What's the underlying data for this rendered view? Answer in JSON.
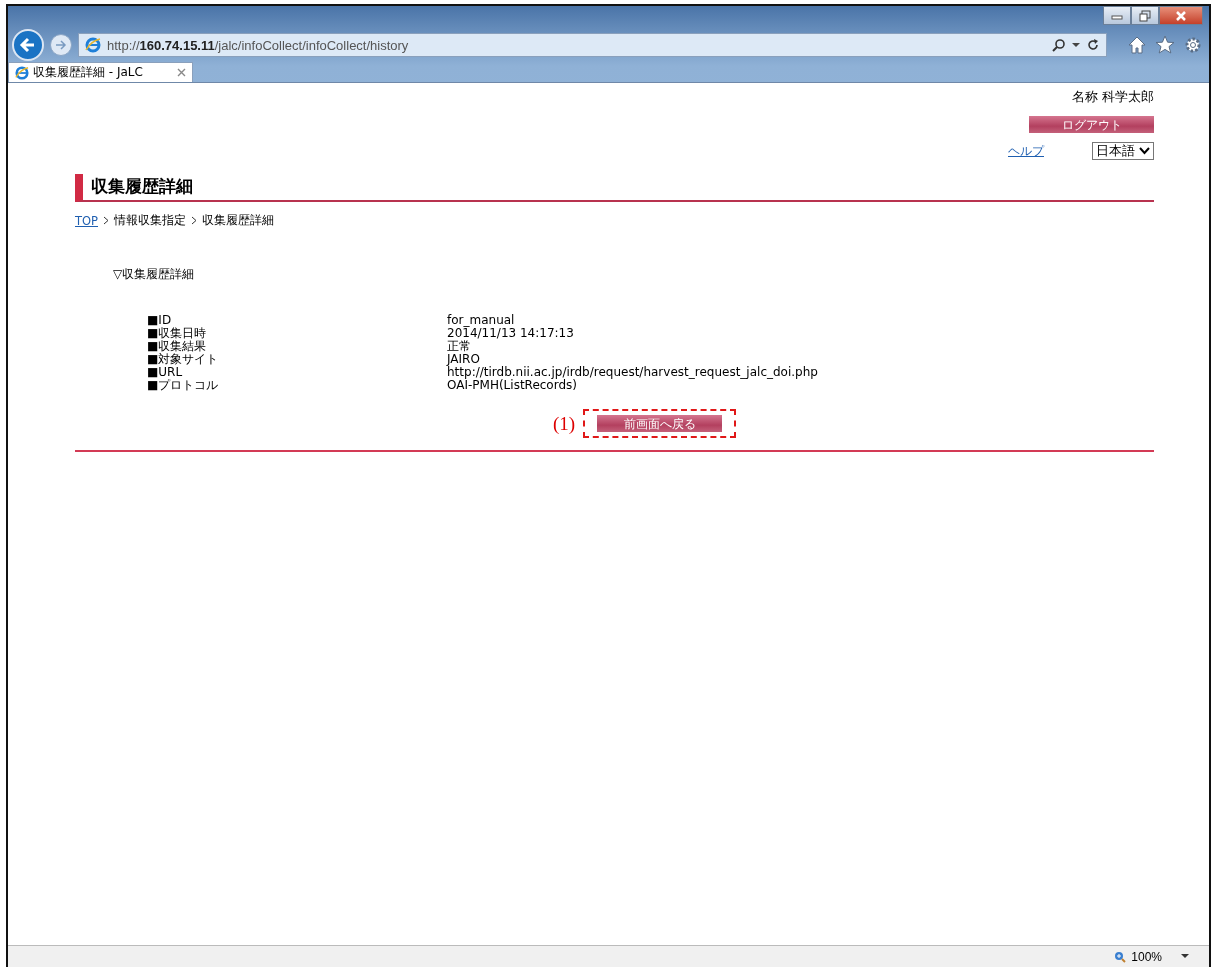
{
  "browser": {
    "url_host": "160.74.15.11",
    "url_scheme": "http://",
    "url_path": "/jalc/infoCollect/infoCollect/history",
    "tab_title": "収集履歴詳細 - JaLC",
    "zoom": "100%"
  },
  "header": {
    "user_name": "名称 科学太郎",
    "logout_button": "ログアウト",
    "help_link": "ヘルプ",
    "language": "日本語"
  },
  "page_title": "収集履歴詳細",
  "breadcrumb": [
    {
      "label": "TOP",
      "link": true
    },
    {
      "label": "情報収集指定",
      "link": false
    },
    {
      "label": "収集履歴詳細",
      "link": false
    }
  ],
  "section_heading": "▽収集履歴詳細",
  "details": [
    {
      "label": "■ID",
      "value": "for_manual"
    },
    {
      "label": "■収集日時",
      "value": "2014/11/13 14:17:13"
    },
    {
      "label": "■収集結果",
      "value": "正常"
    },
    {
      "label": "■対象サイト",
      "value": "JAIRO"
    },
    {
      "label": "■URL",
      "value": "http://tirdb.nii.ac.jp/irdb/request/harvest_request_jalc_doi.php"
    },
    {
      "label": "■プロトコル",
      "value": "OAI-PMH(ListRecords)"
    }
  ],
  "callout": "(1)",
  "back_button": "前画面へ戻る"
}
